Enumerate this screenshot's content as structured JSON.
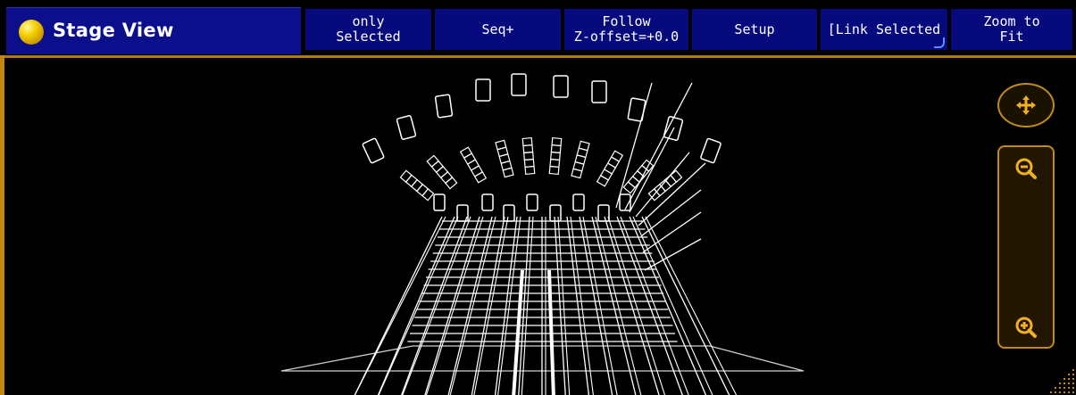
{
  "window": {
    "title": "Stage View"
  },
  "toolbar": {
    "buttons": [
      {
        "id": "only-selected",
        "label": "only\nSelected"
      },
      {
        "id": "seq-plus",
        "label": "Seq+"
      },
      {
        "id": "follow",
        "label": "Follow\nZ-offset=+0.0"
      },
      {
        "id": "setup",
        "label": "Setup"
      },
      {
        "id": "link-selected",
        "label": "[Link Selected"
      },
      {
        "id": "zoom-to-fit",
        "label": "Zoom to\nFit"
      }
    ]
  },
  "controls": {
    "move_icon": "move-arrows-icon",
    "zoom_out_icon": "zoom-out-icon",
    "zoom_in_icon": "zoom-in-icon"
  },
  "colors": {
    "title_bg": "#0b0f8c",
    "button_bg": "#060a7c",
    "accent": "#c08c15",
    "wire": "#ffffff"
  }
}
